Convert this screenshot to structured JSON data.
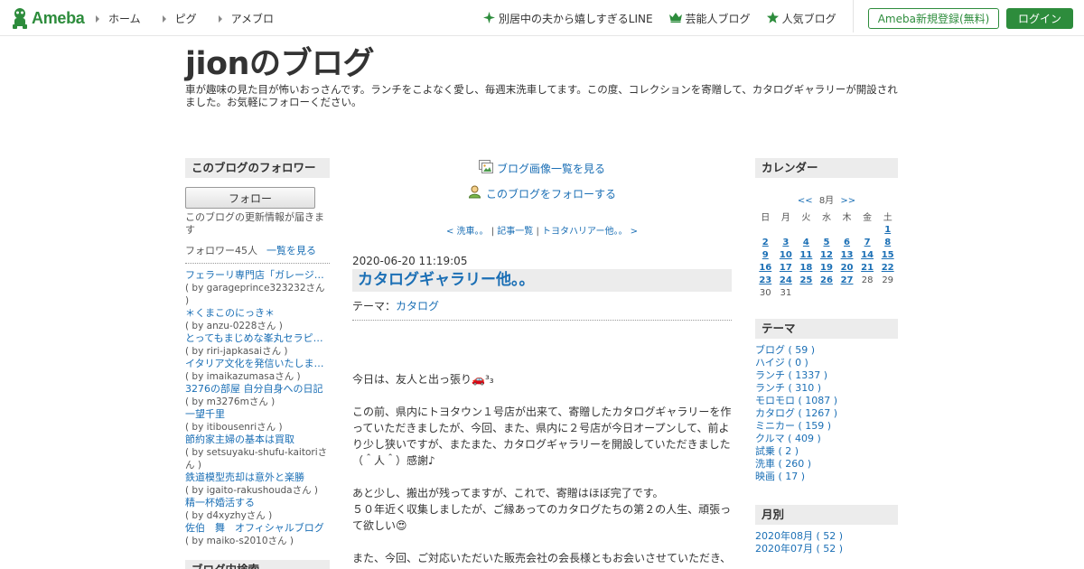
{
  "header": {
    "logo_text": "Ameba",
    "nav": [
      {
        "label": "ホーム"
      },
      {
        "label": "ピグ"
      },
      {
        "label": "アメブロ"
      }
    ],
    "promo": [
      {
        "label": "別居中の夫から嬉しすぎるLINE",
        "icon": "sparkle-icon"
      },
      {
        "label": "芸能人ブログ",
        "icon": "crown-icon"
      },
      {
        "label": "人気ブログ",
        "icon": "star-icon"
      }
    ],
    "register_label": "Ameba新規登録(無料)",
    "login_label": "ログイン",
    "brand_color": "#2d8c3c"
  },
  "blog": {
    "title": "jionのブログ",
    "description": "車が趣味の見た目が怖いおっさんです。ランチをこよなく愛し、毎週末洗車してます。この度、コレクションを寄贈して、カタログギャラリーが開設されました。お気軽にフォローください。"
  },
  "left": {
    "followers_heading": "このブログのフォロワー",
    "follow_button": "フォロー",
    "follow_note": "このブログの更新情報が届きます",
    "follower_count": "フォロワー45人",
    "follower_list_link": "一覧を見る",
    "followers": [
      {
        "name": "フェラーリ専門店「ガレージ…",
        "by": "( by garageprince323232さん )"
      },
      {
        "name": "＊くまこのにっき＊",
        "by": "( by anzu-0228さん )"
      },
      {
        "name": "とってもまじめな峯丸セラピ…",
        "by": "( by riri-japkasaiさん )"
      },
      {
        "name": "イタリア文化を発信いたしま…",
        "by": "( by imaikazumasaさん )"
      },
      {
        "name": "3276の部屋 自分自身への日記",
        "by": "( by m3276mさん )"
      },
      {
        "name": "一望千里",
        "by": "( by itibousenriさん )"
      },
      {
        "name": "節約家主婦の基本は買取",
        "by": "( by setsuyaku-shufu-kaitoriさん )"
      },
      {
        "name": "鉄道模型売却は意外と楽勝",
        "by": "( by igaito-rakushoudaさん )"
      },
      {
        "name": "精一杯婚活する",
        "by": "( by d4xyzhyさん )"
      },
      {
        "name": "佐伯　舞　オフィシャルブログ",
        "by": "( by maiko-s2010さん )"
      }
    ],
    "search_heading": "ブログ内検索"
  },
  "center": {
    "image_list_link": "ブログ画像一覧を見る",
    "follow_link": "このブログをフォローする",
    "prev_link": "< 洗車。。",
    "list_link": "記事一覧",
    "next_link": "トヨタハリアー他。。 >",
    "post_date": "2020-06-20 11:19:05",
    "post_title": "カタログギャラリー他。。",
    "theme_label": "テーマ：",
    "theme_value": "カタログ",
    "body": [
      "今日は、友人と出っ張り🚗³₃",
      "この前、県内にトヨタウン１号店が出来て、寄贈したカタログギャラリーを作っていただきましたが、今回、また、県内に２号店が今日オープンして、前より少し狭いですが、またまた、カタログギャラリーを開設していただきました（＾人＾）感謝♪",
      "あと少し、搬出が残ってますが、これで、寄贈はほぼ完了です。\n５０年近く収集しましたが、ご縁あってのカタログたちの第２の人生、頑張って欲しい😍",
      "また、今回、ご対応いただいた販売会社の会長様ともお会いさせていただき、"
    ]
  },
  "right": {
    "calendar_heading": "カレンダー",
    "cal_prev": "<<",
    "cal_month": "8月",
    "cal_next": ">>",
    "weekdays": [
      "日",
      "月",
      "火",
      "水",
      "木",
      "金",
      "土"
    ],
    "weeks": [
      [
        "",
        "",
        "",
        "",
        "",
        "",
        "1"
      ],
      [
        "2",
        "3",
        "4",
        "5",
        "6",
        "7",
        "8"
      ],
      [
        "9",
        "10",
        "11",
        "12",
        "13",
        "14",
        "15"
      ],
      [
        "16",
        "17",
        "18",
        "19",
        "20",
        "21",
        "22"
      ],
      [
        "23",
        "24",
        "25",
        "26",
        "27",
        "28",
        "29"
      ],
      [
        "30",
        "31",
        "",
        "",
        "",
        "",
        ""
      ]
    ],
    "linked_days": [
      "1",
      "2",
      "3",
      "4",
      "5",
      "6",
      "7",
      "8",
      "9",
      "10",
      "11",
      "12",
      "13",
      "14",
      "15",
      "16",
      "17",
      "18",
      "19",
      "20",
      "21",
      "22",
      "23",
      "24",
      "25",
      "26",
      "27"
    ],
    "theme_heading": "テーマ",
    "themes": [
      "ブログ ( 59 )",
      "ハイジ ( 0 )",
      "ランチ ( 1337 )",
      "ランチ ( 310 )",
      "モロモロ ( 1087 )",
      "カタログ ( 1267 )",
      "ミニカー ( 159 )",
      "クルマ ( 409 )",
      "試乗 ( 2 )",
      "洗車 ( 260 )",
      "映画 ( 17 )"
    ],
    "month_heading": "月別",
    "months": [
      "2020年08月 ( 52 )",
      "2020年07月 ( 52 )"
    ]
  }
}
